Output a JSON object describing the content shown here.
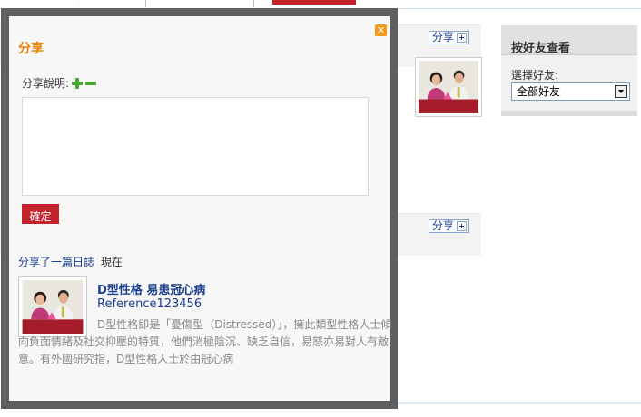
{
  "background": {
    "share_button_label": "分享",
    "right_panel": {
      "title": "按好友查看",
      "select_label": "選擇好友:",
      "select_value": "全部好友"
    }
  },
  "modal": {
    "title": "分享",
    "description_label": "分享說明:",
    "description_value": "",
    "confirm_label": "確定",
    "shared_text": "分享了一篇日誌",
    "time_text": "現在",
    "post": {
      "title": "D型性格 易患冠心病",
      "reference": "Reference123456",
      "excerpt": "D型性格即是「憂傷型（Distressed）」，擁此類型性格人士傾向負面情緒及社交抑壓的特質，他們消極陰沉、缺乏自信，易怒亦易對人有敵意。有外國研究指，D型性格人士於由冠心病"
    }
  },
  "colors": {
    "accent_orange": "#e8850d",
    "link_blue": "#1a3d8f",
    "button_red": "#c4232b",
    "modal_border": "#5f5f5f"
  },
  "icons": [
    "close-icon",
    "add-icon",
    "remove-icon",
    "plus-icon",
    "dropdown-arrow-icon"
  ]
}
